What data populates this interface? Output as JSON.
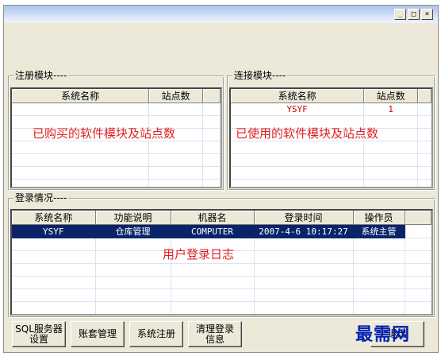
{
  "window": {
    "buttons": [
      "_",
      "□",
      "×"
    ]
  },
  "register": {
    "legend": "注册模块----",
    "columns": [
      "系统名称",
      "站点数"
    ],
    "overlay": "已购买的软件模块及站点数"
  },
  "connect": {
    "legend": "连接模块----",
    "columns": [
      "系统名称",
      "站点数"
    ],
    "rows": [
      [
        "YSYF",
        "1"
      ]
    ],
    "overlay": "已使用的软件模块及站点数"
  },
  "login": {
    "legend": "登录情况----",
    "columns": [
      "系统名称",
      "功能说明",
      "机器名",
      "登录时间",
      "操作员"
    ],
    "rows": [
      [
        "YSYF",
        "仓库管理",
        "COMPUTER",
        "2007-4-6 10:17:27",
        "系统主管"
      ]
    ],
    "overlay": "用户登录日志"
  },
  "buttons": {
    "sql_line1": "SQL服务器",
    "sql_line2": "设置",
    "account": "账套管理",
    "sysreg": "系统注册",
    "clear_line1": "清理登录",
    "clear_line2": "信息",
    "exit": "退出"
  },
  "watermark": "最需网",
  "colors": {
    "selection": "#0a246a",
    "overlay_text": "#e02020",
    "watermark": "#0020b0"
  }
}
